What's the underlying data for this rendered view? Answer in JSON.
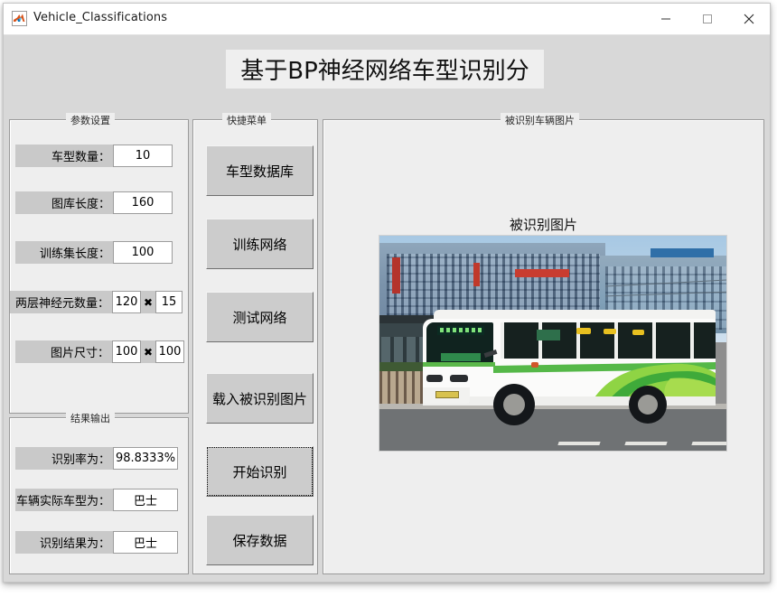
{
  "window": {
    "title": "Vehicle_Classifications",
    "icon": "matlab-icon",
    "minimize_label": "—",
    "maximize_label": "□",
    "close_label": "✕"
  },
  "banner": {
    "text": "基于BP神经网络车型识别分"
  },
  "params_panel": {
    "title": "参数设置",
    "rows": [
      {
        "label": "车型数量：",
        "value": "10"
      },
      {
        "label": "图库长度：",
        "value": "160"
      },
      {
        "label": "训练集长度：",
        "value": "100"
      },
      {
        "label": "两层神经元数量：",
        "value": "120",
        "separator": "✖",
        "value2": "15"
      },
      {
        "label": "图片尺寸：",
        "value": "100",
        "separator": "✖",
        "value2": "100"
      }
    ]
  },
  "results_panel": {
    "title": "结果输出",
    "rows": [
      {
        "label": "识别率为：",
        "value": "98.8333%"
      },
      {
        "label": "车辆实际车型为：",
        "value": "巴士"
      },
      {
        "label": "识别结果为：",
        "value": "巴士"
      }
    ]
  },
  "menu_panel": {
    "title": "快捷菜单",
    "buttons": [
      {
        "label": "车型数据库",
        "focused": false
      },
      {
        "label": "训练网络",
        "focused": false
      },
      {
        "label": "测试网络",
        "focused": false
      },
      {
        "label": "载入被识别图片",
        "focused": false
      },
      {
        "label": "开始识别",
        "focused": true
      },
      {
        "label": "保存数据",
        "focused": false
      }
    ]
  },
  "image_panel": {
    "title": "被识别车辆图片",
    "axes_title": "被识别图片",
    "photo_description": "white-and-green-city-bus-at-stop"
  },
  "colors": {
    "window_bg": "#d8d8d8",
    "panel_bg": "#eeeeee",
    "label_bg": "#c9c9c9",
    "button_bg": "#cccccc",
    "field_bg": "#ffffff",
    "banner_bg": "#efefef",
    "bus_green": "#6cc24a"
  }
}
